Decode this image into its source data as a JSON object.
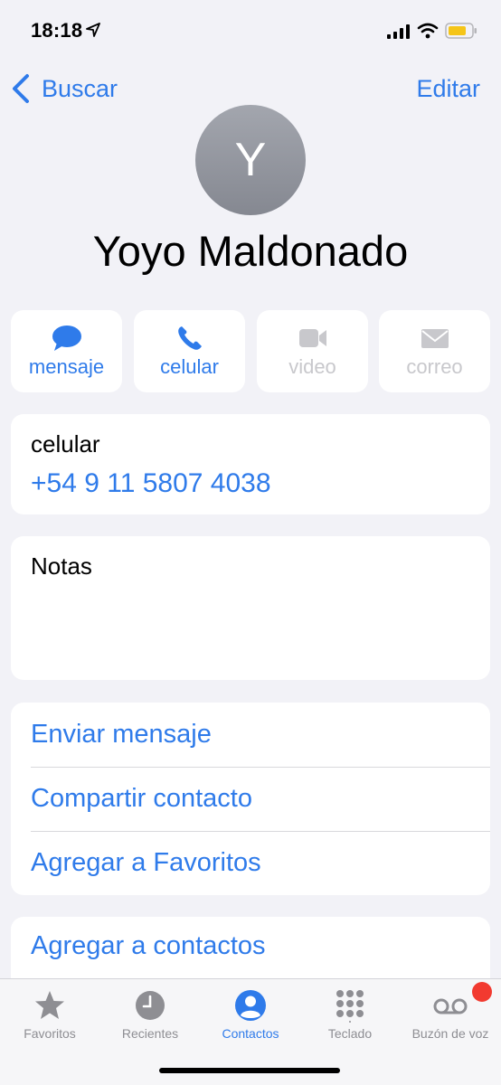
{
  "status": {
    "time": "18:18"
  },
  "nav": {
    "back_label": "Buscar",
    "edit_label": "Editar"
  },
  "contact": {
    "initial": "Y",
    "name": "Yoyo Maldonado"
  },
  "actions": [
    {
      "label": "mensaje",
      "icon": "message-bubble-icon",
      "enabled": true
    },
    {
      "label": "celular",
      "icon": "phone-icon",
      "enabled": true
    },
    {
      "label": "video",
      "icon": "video-camera-icon",
      "enabled": false
    },
    {
      "label": "correo",
      "icon": "envelope-icon",
      "enabled": false
    }
  ],
  "phone": {
    "label": "celular",
    "number": "+54 9 11 5807 4038"
  },
  "notes": {
    "label": "Notas"
  },
  "options": [
    "Enviar mensaje",
    "Compartir contacto",
    "Agregar a Favoritos"
  ],
  "add_contact": {
    "label": "Agregar a contactos"
  },
  "tabs": [
    {
      "label": "Favoritos",
      "icon": "star-icon",
      "active": false
    },
    {
      "label": "Recientes",
      "icon": "clock-icon",
      "active": false
    },
    {
      "label": "Contactos",
      "icon": "person-circle-icon",
      "active": true
    },
    {
      "label": "Teclado",
      "icon": "keypad-icon",
      "active": false
    },
    {
      "label": "Buzón de voz",
      "icon": "voicemail-icon",
      "active": false
    }
  ],
  "colors": {
    "accent": "#2f7bea",
    "background": "#f2f2f7",
    "disabled": "#c8c8cc",
    "badge": "#f23a30"
  }
}
